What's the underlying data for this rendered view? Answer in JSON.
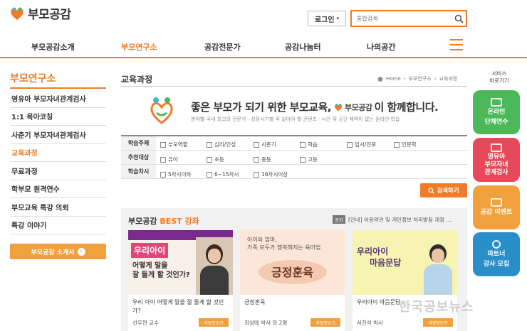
{
  "header": {
    "logo_text": "부모공감",
    "login_label": "로그인",
    "search_placeholder": "통합검색"
  },
  "gnb": {
    "items": [
      "부모공감소개",
      "부모연구소",
      "공감전문가",
      "공감나눔터",
      "나의공간"
    ],
    "active_index": 1
  },
  "sidebar": {
    "title": "부모연구소",
    "items": [
      "영유아 부모자녀관계검사",
      "1:1 육아코칭",
      "사춘기 부모자녀관계검사",
      "교육과정",
      "무료과정",
      "학부모 원격연수",
      "부모교육 특강 의뢰",
      "특강 이야기"
    ],
    "active_index": 3,
    "intro_button": "부모공감 소개서"
  },
  "main": {
    "page_title": "교육과정",
    "breadcrumb": [
      "Home",
      "부모연구소",
      "교육과정"
    ],
    "banner": {
      "headline_before": "좋은 부모가 되기 위한 부모교육,",
      "headline_brand": "부모공감",
      "headline_after": "이 함께합니다.",
      "subtext": "분야별 국내 최고의 전문가 · 성장시기별 꼭 알아야 할 콘텐츠 · 시간 및 공간 제약이 없는 온라인 학습"
    },
    "filter": {
      "rows": [
        {
          "label": "학습주제",
          "options": [
            "부모역할",
            "심리/인성",
            "사춘기",
            "학습",
            "입시/진로",
            "인문학"
          ]
        },
        {
          "label": "추천대상",
          "options": [
            "유아",
            "초등",
            "중등",
            "고등"
          ]
        },
        {
          "label": "학습차시",
          "options": [
            "5차시이하",
            "6~15차시",
            "16차시이상"
          ]
        }
      ],
      "search_button": "검색하기"
    },
    "best": {
      "title_prefix": "부모공감",
      "title_suffix": "BEST 강좌",
      "notice_tag": "공지",
      "notice_text": "[안내] 이용약관 및 개인정보 처리방침 개정 ...",
      "cards": [
        {
          "thumb_line1": "우리아이",
          "thumb_line2": "어떻게 말을",
          "thumb_line3": "잘 들게 할 것인가?",
          "title": "우리 아이 어떻게 말을 잘 들게 할 것인가?",
          "author": "선우현 교수",
          "button": "과정맛보기"
        },
        {
          "thumb_line1": "아이와 엄마,",
          "thumb_line2": "가족 모두가 행복해지는 육아법",
          "thumb_line3": "긍정훈육",
          "title": "긍정훈육",
          "author": "최성애 박사 외 2명",
          "button": "과정맛보기"
        },
        {
          "thumb_line1": "우리아이",
          "thumb_line2": "마음문답",
          "thumb_line3": "",
          "title": "우리아이 마음문답",
          "author": "서천석 박사",
          "button": "과정맛보기"
        }
      ]
    }
  },
  "quick_menu": {
    "label_line1": "서비스",
    "label_line2": "바로가기",
    "items": [
      {
        "line1": "온라인",
        "line2": "단체연수",
        "color": "#4bb85a"
      },
      {
        "line1": "영유아",
        "line2": "부모자녀",
        "line3": "관계검사",
        "color": "#e8495a"
      },
      {
        "line1": "공감 이벤트",
        "line2": "",
        "color": "#f0a03c"
      },
      {
        "line1": "파트너",
        "line2": "강사 모집",
        "color": "#2a8fc8"
      }
    ]
  },
  "watermark": "한국공보뉴스",
  "colors": {
    "accent": "#f07c2a",
    "side_button": "#f0a03c"
  }
}
